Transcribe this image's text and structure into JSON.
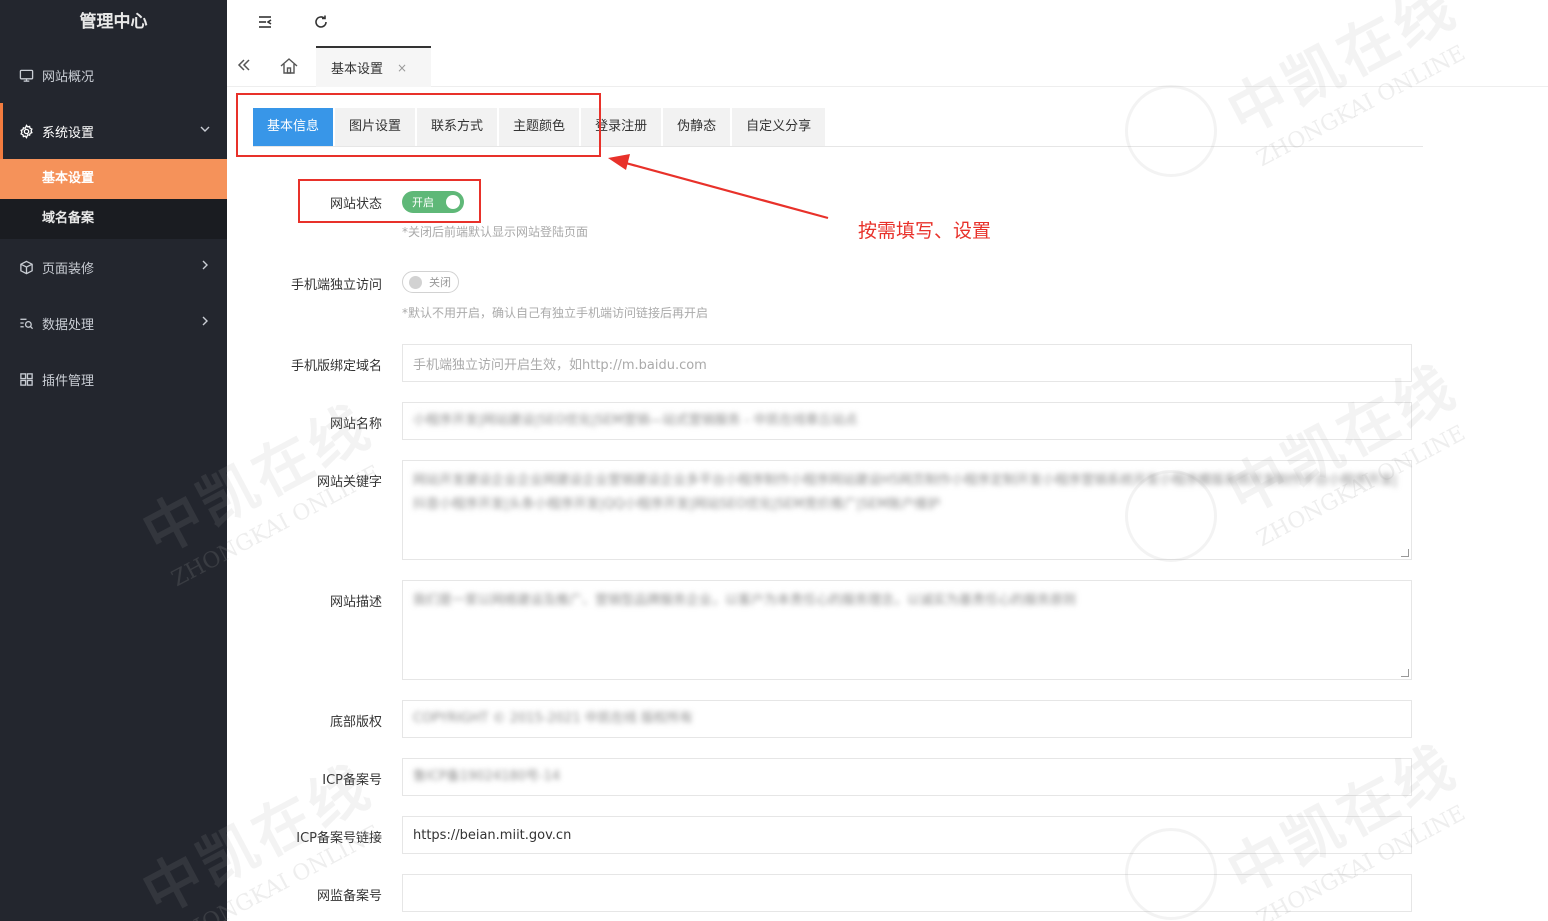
{
  "sidebar": {
    "title": "管理中心",
    "items": [
      {
        "label": "网站概况",
        "icon": "monitor-icon"
      },
      {
        "label": "系统设置",
        "icon": "gear-icon"
      },
      {
        "label": "页面装修",
        "icon": "cube-icon"
      },
      {
        "label": "数据处理",
        "icon": "data-search-icon"
      },
      {
        "label": "插件管理",
        "icon": "grid-icon"
      }
    ],
    "subitems": [
      {
        "label": "基本设置"
      },
      {
        "label": "域名备案"
      }
    ]
  },
  "tabbar": {
    "open_tab": "基本设置",
    "close_glyph": "×"
  },
  "subtabs": [
    "基本信息",
    "图片设置",
    "联系方式",
    "主题颜色",
    "登录注册",
    "伪静态",
    "自定义分享"
  ],
  "form": {
    "site_status": {
      "label": "网站状态",
      "switch_text": "开启",
      "hint": "*关闭后前端默认显示网站登陆页面"
    },
    "mobile_access": {
      "label": "手机端独立访问",
      "switch_text": "关闭",
      "hint": "*默认不用开启，确认自己有独立手机端访问链接后再开启"
    },
    "mobile_domain": {
      "label": "手机版绑定域名",
      "placeholder": "手机端独立访问开启生效，如http://m.baidu.com"
    },
    "site_name": {
      "label": "网站名称",
      "value": "小程序开发|网站建设|SEO优化|SEM营销—站式营销服务 - 中凯在线章丘站点"
    },
    "site_keywords": {
      "label": "网站关键字",
      "value": "网站开发建设企业企业网建设企业营销建设企业多平台小程序制作小程序网站建设H5网页制作小程序定制开发小程序营销系统开发小程序模版系统开发制作平台小程序开发|抖音小程序开发|头条小程序开发|QQ小程序开发|网站SEO优化|SEM竞价推广|SEM账户维护"
    },
    "site_description": {
      "label": "网站描述",
      "value": "我们是一家以网络建设及推广、营销型品牌服务企业，以客户为本责任心的服务理念，以诚实为基责任心的服务原则"
    },
    "copyright": {
      "label": "底部版权",
      "value": "COPYRIGHT © 2015-2021 中凯在线 版权所有"
    },
    "icp": {
      "label": "ICP备案号",
      "value": "鲁ICP备19024180号-14"
    },
    "icp_link": {
      "label": "ICP备案号链接",
      "value": "https://beian.miit.gov.cn"
    },
    "police": {
      "label": "网监备案号",
      "value": ""
    }
  },
  "annotation": {
    "text": "按需填写、设置",
    "color": "#e8312a"
  },
  "watermark": {
    "cn": "中凯在线",
    "en": "ZHONGKAI ONLINE"
  },
  "colors": {
    "accent": "#f37c3f",
    "tab_active": "#3896e8",
    "switch_on": "#5fb878",
    "sidebar_bg": "#23262e"
  }
}
